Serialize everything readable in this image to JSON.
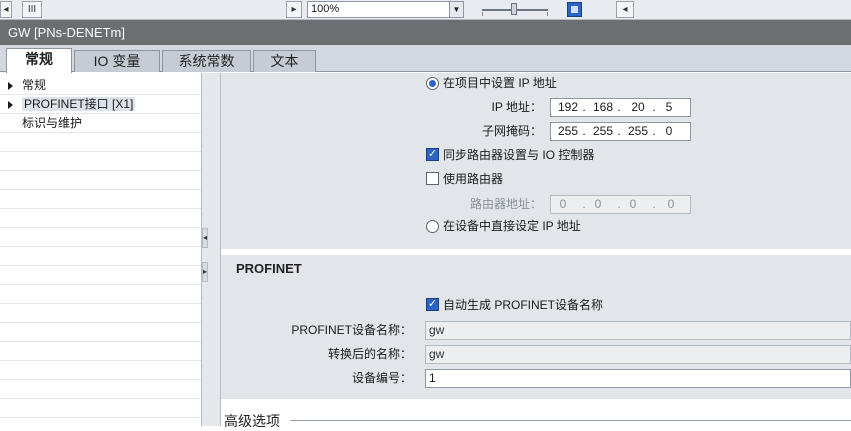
{
  "toolbar": {
    "scroll_left_glyph": "◂",
    "thumb_glyph": "III",
    "scroll_right_glyph": "▸",
    "zoom_value": "100%",
    "zoom_dropdown_glyph": "▼",
    "zoom_slider_level": 0.45,
    "nav_left_glyph": "◂"
  },
  "window": {
    "title": "GW [PNs-DENETm]"
  },
  "tabs": [
    {
      "label": "常规",
      "active": true
    },
    {
      "label": "IO 变量",
      "active": false
    },
    {
      "label": "系统常数",
      "active": false
    },
    {
      "label": "文本",
      "active": false
    }
  ],
  "tree": [
    {
      "label": "常规",
      "expandable": true,
      "selected": false
    },
    {
      "label": "PROFINET接口 [X1]",
      "expandable": true,
      "selected": true
    },
    {
      "label": "标识与维护",
      "expandable": false,
      "selected": false
    }
  ],
  "splitter": {
    "collapse_glyph": "◂",
    "expand_glyph": "▸"
  },
  "ip": {
    "set_in_project_label": "在项目中设置 IP 地址",
    "set_in_project_selected": true,
    "ip_address_label": "IP 地址：",
    "ip_address": [
      "192",
      "168",
      "20",
      "5"
    ],
    "subnet_label": "子网掩码：",
    "subnet": [
      "255",
      "255",
      "255",
      "0"
    ],
    "sync_router_label": "同步路由器设置与 IO 控制器",
    "sync_router_checked": true,
    "use_router_label": "使用路由器",
    "use_router_checked": false,
    "router_address_label": "路由器地址：",
    "router_address": [
      "0",
      "0",
      "0",
      "0"
    ],
    "set_on_device_label": "在设备中直接设定 IP 地址",
    "set_on_device_selected": false,
    "separator": "."
  },
  "profinet": {
    "section_title": "PROFINET",
    "auto_name_label": "自动生成 PROFINET设备名称",
    "auto_name_checked": true,
    "device_name_label": "PROFINET设备名称：",
    "device_name": "gw",
    "converted_name_label": "转换后的名称：",
    "converted_name": "gw",
    "device_number_label": "设备编号：",
    "device_number": "1"
  },
  "advanced": {
    "label": "高级选项"
  },
  "colors": {
    "accent": "#2b64c4",
    "panel": "#e2e6ea",
    "title_bar": "#6c6f72"
  }
}
